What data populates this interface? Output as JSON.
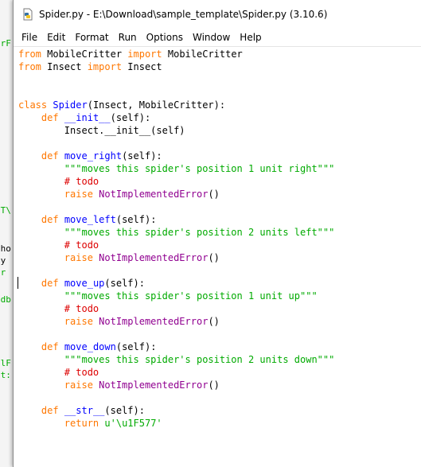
{
  "window": {
    "title": "Spider.py - E:\\Download\\sample_template\\Spider.py (3.10.6)"
  },
  "menu": [
    "File",
    "Edit",
    "Format",
    "Run",
    "Options",
    "Window",
    "Help"
  ],
  "background_fragments": [
    "erF",
    "NT\\",
    "cho",
    "cy",
    "\\r",
    "odb",
    "alF",
    "at:"
  ],
  "code_lines": [
    [
      {
        "t": "from",
        "c": "kw"
      },
      {
        "t": " MobileCritter ",
        "c": "txt"
      },
      {
        "t": "import",
        "c": "kw"
      },
      {
        "t": " MobileCritter",
        "c": "txt"
      }
    ],
    [
      {
        "t": "from",
        "c": "kw"
      },
      {
        "t": " Insect ",
        "c": "txt"
      },
      {
        "t": "import",
        "c": "kw"
      },
      {
        "t": " Insect",
        "c": "txt"
      }
    ],
    [],
    [],
    [
      {
        "t": "class",
        "c": "kw"
      },
      {
        "t": " ",
        "c": "txt"
      },
      {
        "t": "Spider",
        "c": "def"
      },
      {
        "t": "(Insect, MobileCritter):",
        "c": "txt"
      }
    ],
    [
      {
        "t": "    ",
        "c": "txt"
      },
      {
        "t": "def",
        "c": "kw"
      },
      {
        "t": " ",
        "c": "txt"
      },
      {
        "t": "__init__",
        "c": "def"
      },
      {
        "t": "(self):",
        "c": "txt"
      }
    ],
    [
      {
        "t": "        Insect.__init__(self)",
        "c": "txt"
      }
    ],
    [],
    [
      {
        "t": "    ",
        "c": "txt"
      },
      {
        "t": "def",
        "c": "kw"
      },
      {
        "t": " ",
        "c": "txt"
      },
      {
        "t": "move_right",
        "c": "def"
      },
      {
        "t": "(self):",
        "c": "txt"
      }
    ],
    [
      {
        "t": "        ",
        "c": "txt"
      },
      {
        "t": "\"\"\"moves this spider's position 1 unit right\"\"\"",
        "c": "str"
      }
    ],
    [
      {
        "t": "        ",
        "c": "txt"
      },
      {
        "t": "# todo",
        "c": "cmt"
      }
    ],
    [
      {
        "t": "        ",
        "c": "txt"
      },
      {
        "t": "raise",
        "c": "kw"
      },
      {
        "t": " ",
        "c": "txt"
      },
      {
        "t": "NotImplementedError",
        "c": "builtin"
      },
      {
        "t": "()",
        "c": "txt"
      }
    ],
    [],
    [
      {
        "t": "    ",
        "c": "txt"
      },
      {
        "t": "def",
        "c": "kw"
      },
      {
        "t": " ",
        "c": "txt"
      },
      {
        "t": "move_left",
        "c": "def"
      },
      {
        "t": "(self):",
        "c": "txt"
      }
    ],
    [
      {
        "t": "        ",
        "c": "txt"
      },
      {
        "t": "\"\"\"moves this spider's position 2 units left\"\"\"",
        "c": "str"
      }
    ],
    [
      {
        "t": "        ",
        "c": "txt"
      },
      {
        "t": "# todo",
        "c": "cmt"
      }
    ],
    [
      {
        "t": "        ",
        "c": "txt"
      },
      {
        "t": "raise",
        "c": "kw"
      },
      {
        "t": " ",
        "c": "txt"
      },
      {
        "t": "NotImplementedError",
        "c": "builtin"
      },
      {
        "t": "()",
        "c": "txt"
      }
    ],
    [],
    [
      {
        "t": "    ",
        "c": "txt"
      },
      {
        "t": "def",
        "c": "kw"
      },
      {
        "t": " ",
        "c": "txt"
      },
      {
        "t": "move_up",
        "c": "def"
      },
      {
        "t": "(self):",
        "c": "txt"
      }
    ],
    [
      {
        "t": "        ",
        "c": "txt"
      },
      {
        "t": "\"\"\"moves this spider's position 1 unit up\"\"\"",
        "c": "str"
      }
    ],
    [
      {
        "t": "        ",
        "c": "txt"
      },
      {
        "t": "# todo",
        "c": "cmt"
      }
    ],
    [
      {
        "t": "        ",
        "c": "txt"
      },
      {
        "t": "raise",
        "c": "kw"
      },
      {
        "t": " ",
        "c": "txt"
      },
      {
        "t": "NotImplementedError",
        "c": "builtin"
      },
      {
        "t": "()",
        "c": "txt"
      }
    ],
    [],
    [
      {
        "t": "    ",
        "c": "txt"
      },
      {
        "t": "def",
        "c": "kw"
      },
      {
        "t": " ",
        "c": "txt"
      },
      {
        "t": "move_down",
        "c": "def"
      },
      {
        "t": "(self):",
        "c": "txt"
      }
    ],
    [
      {
        "t": "        ",
        "c": "txt"
      },
      {
        "t": "\"\"\"moves this spider's position 2 units down\"\"\"",
        "c": "str"
      }
    ],
    [
      {
        "t": "        ",
        "c": "txt"
      },
      {
        "t": "# todo",
        "c": "cmt"
      }
    ],
    [
      {
        "t": "        ",
        "c": "txt"
      },
      {
        "t": "raise",
        "c": "kw"
      },
      {
        "t": " ",
        "c": "txt"
      },
      {
        "t": "NotImplementedError",
        "c": "builtin"
      },
      {
        "t": "()",
        "c": "txt"
      }
    ],
    [],
    [
      {
        "t": "    ",
        "c": "txt"
      },
      {
        "t": "def",
        "c": "kw"
      },
      {
        "t": " ",
        "c": "txt"
      },
      {
        "t": "__str__",
        "c": "def"
      },
      {
        "t": "(self):",
        "c": "txt"
      }
    ],
    [
      {
        "t": "        ",
        "c": "txt"
      },
      {
        "t": "return",
        "c": "kw"
      },
      {
        "t": " ",
        "c": "txt"
      },
      {
        "t": "u'\\u1F577'",
        "c": "str"
      }
    ]
  ],
  "colors": {
    "keyword": "#ff7700",
    "definition": "#0000ff",
    "builtin": "#900090",
    "string": "#00aa00",
    "comment": "#dd0000"
  }
}
